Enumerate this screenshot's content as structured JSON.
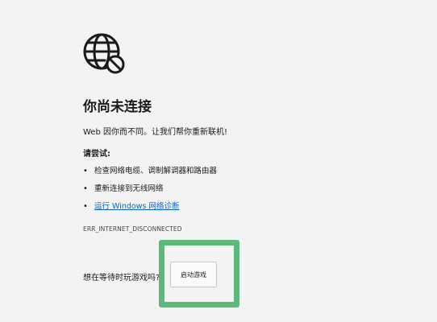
{
  "title": "你尚未连接",
  "subtitle": "Web 因你而不同。让我们帮你重新联机!",
  "try_label": "请尝试:",
  "suggestions": [
    {
      "label": "检查网络电缆、调制解调器和路由器",
      "is_link": false
    },
    {
      "label": "重新连接到无线网络",
      "is_link": false
    },
    {
      "label": "运行 Windows 网络诊断",
      "is_link": true
    }
  ],
  "error_code": "ERR_INTERNET_DISCONNECTED",
  "wait_prompt": "想在等待时玩游戏吗?",
  "game_button_label": "启动游戏",
  "icons": {
    "status": "globe-disconnected-icon"
  },
  "colors": {
    "background": "#f3f3f3",
    "link": "#0a64c8",
    "highlight": "#5bb97b"
  }
}
